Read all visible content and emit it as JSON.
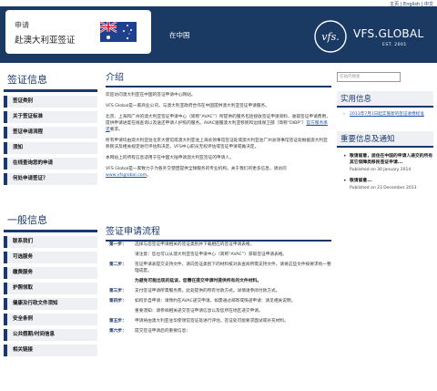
{
  "top_links": {
    "home": "主页",
    "english": "English",
    "chinese": "中文"
  },
  "header": {
    "apply_title": "申请",
    "apply_subtitle": "赴澳大利亚签证",
    "country": "在中国",
    "brand": "VFS.GLOBAL",
    "brand_est": "EST. 2001",
    "brand_mark": "vfs."
  },
  "left_sections": [
    {
      "title": "签证信息",
      "items": [
        "签证类别",
        "关于签证标准",
        "签证申请流程",
        "须知",
        "在线查询您的申请",
        "何处申请签证？"
      ]
    },
    {
      "title": "一般信息",
      "items": [
        "联系我们",
        "可选服务",
        "缴费服务",
        "护照领取",
        "健康及行政文件须知",
        "安全条例",
        "公共假期/时间信息",
        "相关链接"
      ]
    }
  ],
  "main": {
    "intro_title": "介绍",
    "p1": "欢迎访问澳大利亚在中国的签证申请中心网站。",
    "p2": "VFS Global是一家商业公司，与澳大利亚政府合作在中国提供澳大利亚签证申请服务。",
    "p3": "北京、上海和广州的澳大利亚签证申请中心（简称“AVAC”）所提供的服务包括接收签证申请资料、收取签证申请费用，提供申请进度在线查询以及送还申请人护照的服务。AVAC遍服澳大利亚移民和边境保卫部（简称“DIBP”）",
    "p3_link": "官方服务承诺",
    "p3_end": "要求。",
    "p4": "所有申请均由澳大利亚驻北京大使馆或澳大利亚驻上海总领事馆签证处或澳大利亚驻广州总领事馆签证处根据澳大利亚移民法及相关规定进行评估和决定。VFS中心职员无权评估或签证申请或做决定。",
    "p5": "本网站上的所有信息适用于在中国大陆申请澳大利亚签证的申请人。",
    "p6": "VFS Global是一家致力于为各外交使团提供全球服务的专业机构。关于我们的更多信息，请访问",
    "p6_link": "www.vfsglobal.com",
    "p6_end": "。"
  },
  "process": {
    "title": "签证申请流程",
    "steps": [
      {
        "label": "第一步：",
        "text": "选择与您签证申请相关的签证类别并下载相应的签证申请表格。"
      },
      {
        "label": "",
        "text": "请注意：您也可以从澳大利亚签证申请中心（简称“AVAC”）获取签证申请表格。"
      },
      {
        "label": "第二步：",
        "text": "签证申请表提交支持文件，请向签证类别下的材料核对表查阅所需支持文件。请将这些文件按要求统一整理成套。"
      }
    ],
    "note": "为避免可能出现的延误，您需在提交申请时提供所有的文件材料。",
    "steps2": [
      {
        "label": "第三步：",
        "text": "支付签证申请所需服务费。此处提供的所有付款方式。详情请参阅付款方式。"
      },
      {
        "label": "第四步：",
        "text": "如何亲自申请：请预约在AVAC递交申请。如需通过邮寄或快递申请：请见相关说明。"
      },
      {
        "label": "",
        "text": "重要须知：请参阅相关递交签证申请信息以及您所在地区递交申请。"
      },
      {
        "label": "第五步：",
        "text": "申请将由澳大利亚驻华使领馆签证处进行评估，签证处可能要求面试或补充材料。"
      },
      {
        "label": "第六步：",
        "text": "提交签证申请后的重要信息："
      }
    ]
  },
  "right": {
    "search_placeholder": "在站内搜索",
    "useful_title": "实用信息",
    "useful_links": [
      "2013年7月1日起实施新的签证收费标准"
    ],
    "news_title": "重要信息及通知",
    "news": [
      {
        "title": "敬请留意，居住在中国的申请人递交的所有其它保障类移民签证申请...",
        "date": "Published on 30 January 2014"
      },
      {
        "title": "敬请留意...",
        "date": "Published on 23 December 2013"
      }
    ]
  },
  "colors": {
    "navy": "#1a3a64",
    "accent": "#1a3a6e"
  }
}
